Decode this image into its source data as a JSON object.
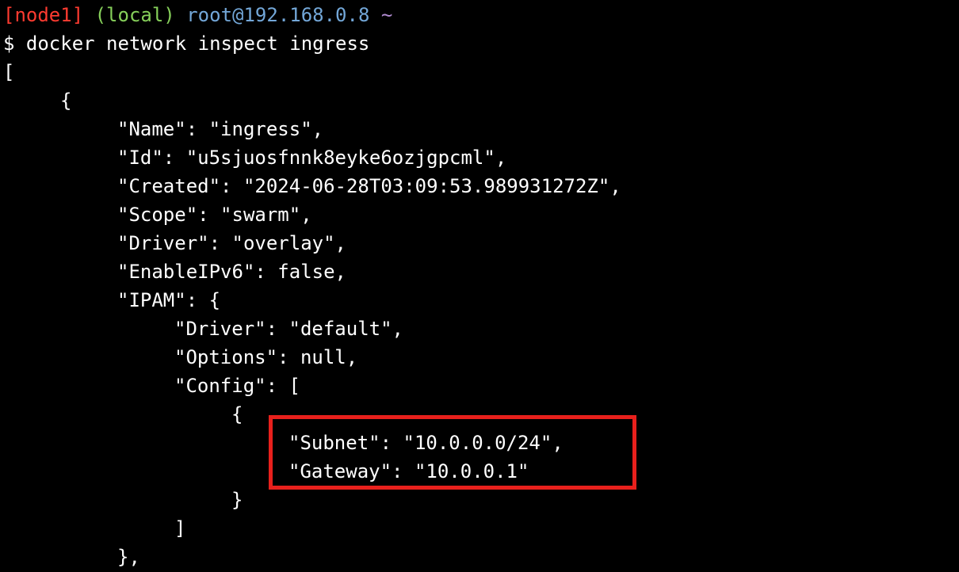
{
  "prompt": {
    "host_tag": "[node1]",
    "env_tag": "(local)",
    "user_host": "root@192.168.0.8",
    "cwd": "~",
    "symbol": "$",
    "command": "docker network inspect ingress"
  },
  "output": {
    "l01": "[",
    "l02": "{",
    "l03": "\"Name\": \"ingress\",",
    "l04": "\"Id\": \"u5sjuosfnnk8eyke6ozjgpcml\",",
    "l05": "\"Created\": \"2024-06-28T03:09:53.989931272Z\",",
    "l06": "\"Scope\": \"swarm\",",
    "l07": "\"Driver\": \"overlay\",",
    "l08": "\"EnableIPv6\": false,",
    "l09": "\"IPAM\": {",
    "l10": "\"Driver\": \"default\",",
    "l11": "\"Options\": null,",
    "l12": "\"Config\": [",
    "l13": "{",
    "l14": "\"Subnet\": \"10.0.0.0/24\",",
    "l15": "\"Gateway\": \"10.0.0.1\"",
    "l16": "}",
    "l17": "]",
    "l18": "},"
  },
  "colors": {
    "background": "#000000",
    "text": "#ffffff",
    "host_tag": "#ff3b30",
    "env_tag": "#86cf5a",
    "user_host": "#73a7d8",
    "cwd": "#b08bd0",
    "highlight_border": "#e8201c"
  }
}
